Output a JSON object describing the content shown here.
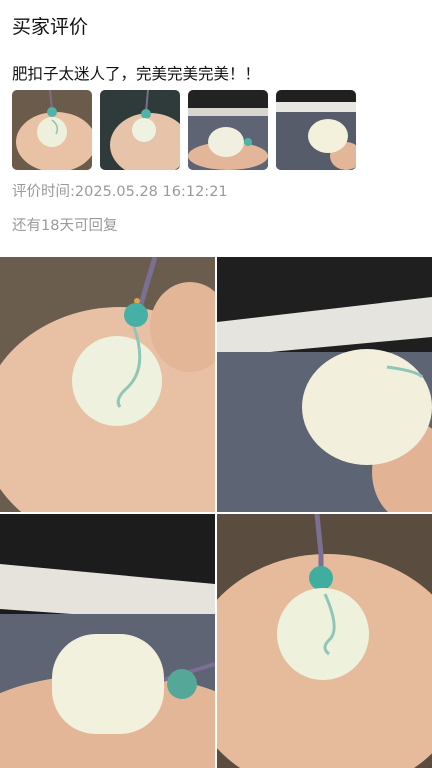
{
  "header": {
    "title": "买家评价"
  },
  "review": {
    "text": "肥扣子太迷人了，完美完美完美！！",
    "timestamp_label": "评价时间:",
    "timestamp": "2025.05.28 16:12:21",
    "reply_notice": "还有18天可回复"
  },
  "thumbnails": [
    {
      "name": "thumb-photo-1"
    },
    {
      "name": "thumb-photo-2"
    },
    {
      "name": "thumb-photo-3"
    },
    {
      "name": "thumb-photo-4"
    }
  ],
  "gallery": [
    {
      "name": "gallery-photo-1"
    },
    {
      "name": "gallery-photo-2"
    },
    {
      "name": "gallery-photo-3"
    },
    {
      "name": "gallery-photo-4"
    }
  ],
  "colors": {
    "text": "#111111",
    "muted": "#9a9a9a",
    "jade": "#eef1dc",
    "turquoise": "#4fb3a8"
  }
}
